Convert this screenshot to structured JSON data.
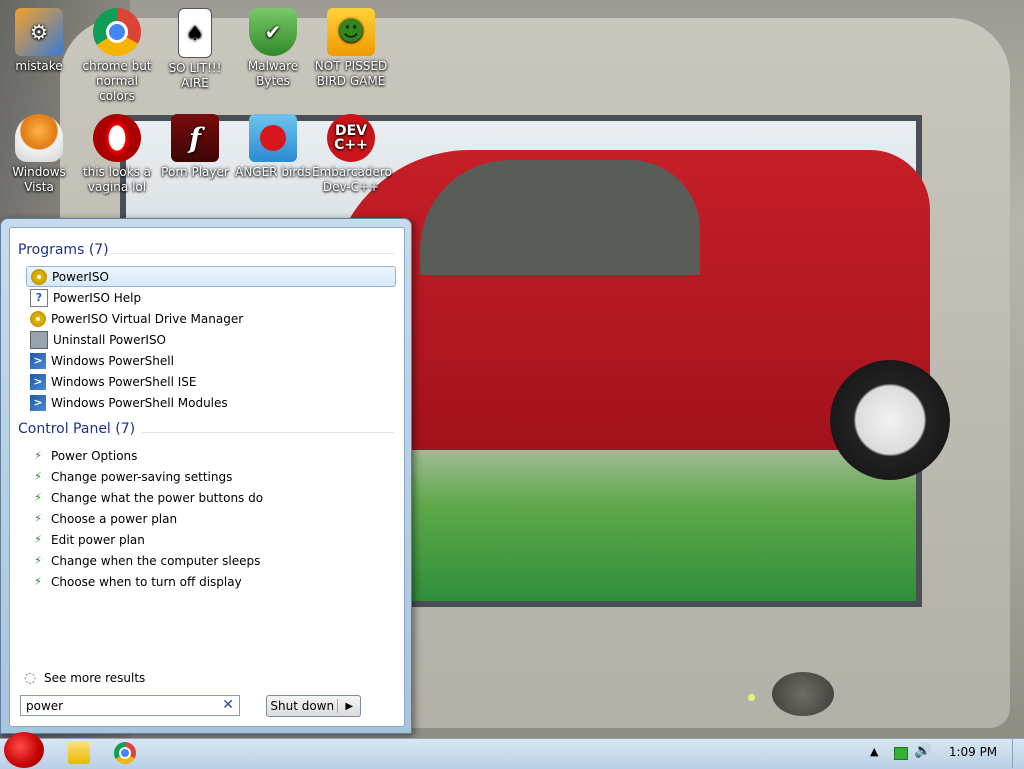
{
  "desktop": {
    "icons": [
      {
        "label": "mistake",
        "glyph": "⚙",
        "icon": "setup-icon"
      },
      {
        "label": "chrome but normal colors",
        "glyph": "",
        "icon": "chrome-icon"
      },
      {
        "label": "SO LIT!!! AIRE",
        "glyph": "♠",
        "icon": "solitaire-icon"
      },
      {
        "label": "Malware Bytes",
        "glyph": "✔",
        "icon": "shield-icon"
      },
      {
        "label": "NOT PISSED BIRD GAME",
        "glyph": "☻",
        "icon": "bad-piggies-icon"
      },
      {
        "label": "Windows Vista",
        "glyph": "",
        "icon": "egg-icon"
      },
      {
        "label": "this looks a vagina lol",
        "glyph": "O",
        "icon": "opera-icon"
      },
      {
        "label": "Porn Player",
        "glyph": "f",
        "icon": "flash-icon"
      },
      {
        "label": "ANGER birds",
        "glyph": "",
        "icon": "angry-birds-icon"
      },
      {
        "label": "Embarcadero Dev-C++",
        "glyph": "DEV C++",
        "icon": "devcpp-icon"
      }
    ]
  },
  "start_menu": {
    "programs_header": "Programs (7)",
    "programs": [
      {
        "label": "PowerISO",
        "icon": "poweriso-icon",
        "kind": "iso"
      },
      {
        "label": "PowerISO Help",
        "icon": "help-icon",
        "kind": "help"
      },
      {
        "label": "PowerISO Virtual Drive Manager",
        "icon": "poweriso-icon",
        "kind": "iso"
      },
      {
        "label": "Uninstall PowerISO",
        "icon": "uninstall-icon",
        "kind": "uninst"
      },
      {
        "label": "Windows PowerShell",
        "icon": "powershell-icon",
        "kind": "ps"
      },
      {
        "label": "Windows PowerShell ISE",
        "icon": "powershell-icon",
        "kind": "ps"
      },
      {
        "label": "Windows PowerShell Modules",
        "icon": "powershell-icon",
        "kind": "ps"
      }
    ],
    "control_panel_header": "Control Panel (7)",
    "control_panel": [
      {
        "label": "Power Options",
        "icon": "power-options-icon"
      },
      {
        "label": "Change power-saving settings",
        "icon": "power-options-icon"
      },
      {
        "label": "Change what the power buttons do",
        "icon": "power-options-icon"
      },
      {
        "label": "Choose a power plan",
        "icon": "power-options-icon"
      },
      {
        "label": "Edit power plan",
        "icon": "power-options-icon"
      },
      {
        "label": "Change when the computer sleeps",
        "icon": "power-options-icon"
      },
      {
        "label": "Choose when to turn off display",
        "icon": "power-options-icon"
      }
    ],
    "see_more": "See more results",
    "search_value": "power",
    "shutdown_label": "Shut down"
  },
  "taskbar": {
    "clock": "1:09 PM"
  }
}
